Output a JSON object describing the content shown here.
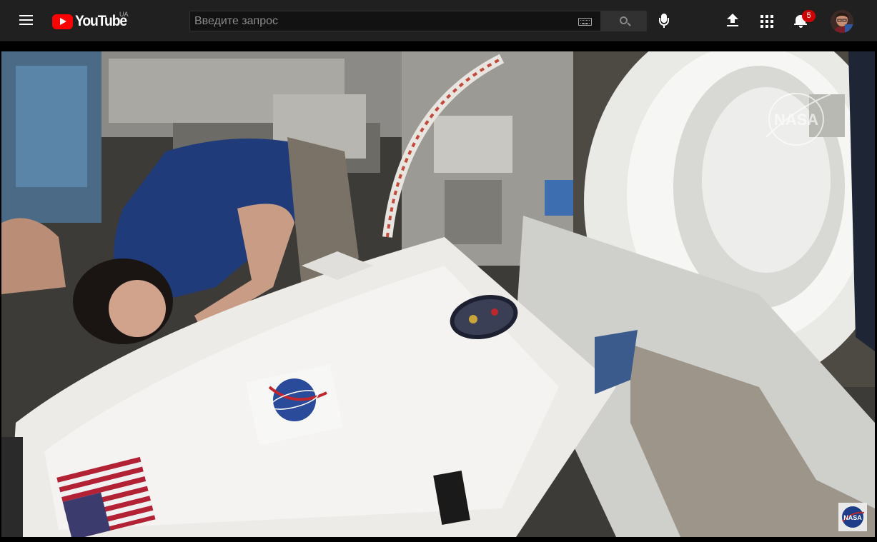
{
  "masthead": {
    "logo_text": "YouTube",
    "country_code": "UA",
    "search_placeholder": "Введите запрос",
    "notification_count": "5"
  },
  "icons": {
    "menu": "hamburger-icon",
    "logo": "youtube-logo-icon",
    "keyboard": "keyboard-icon",
    "search": "search-icon",
    "mic": "microphone-icon",
    "upload": "upload-icon",
    "apps": "apps-grid-icon",
    "notifications": "bell-icon",
    "account": "avatar"
  },
  "video": {
    "watermark_logo": "NASA",
    "corner_logo": "NASA"
  },
  "colors": {
    "masthead_bg": "#202020",
    "brand_red": "#ff0000",
    "badge_red": "#cc0000"
  }
}
